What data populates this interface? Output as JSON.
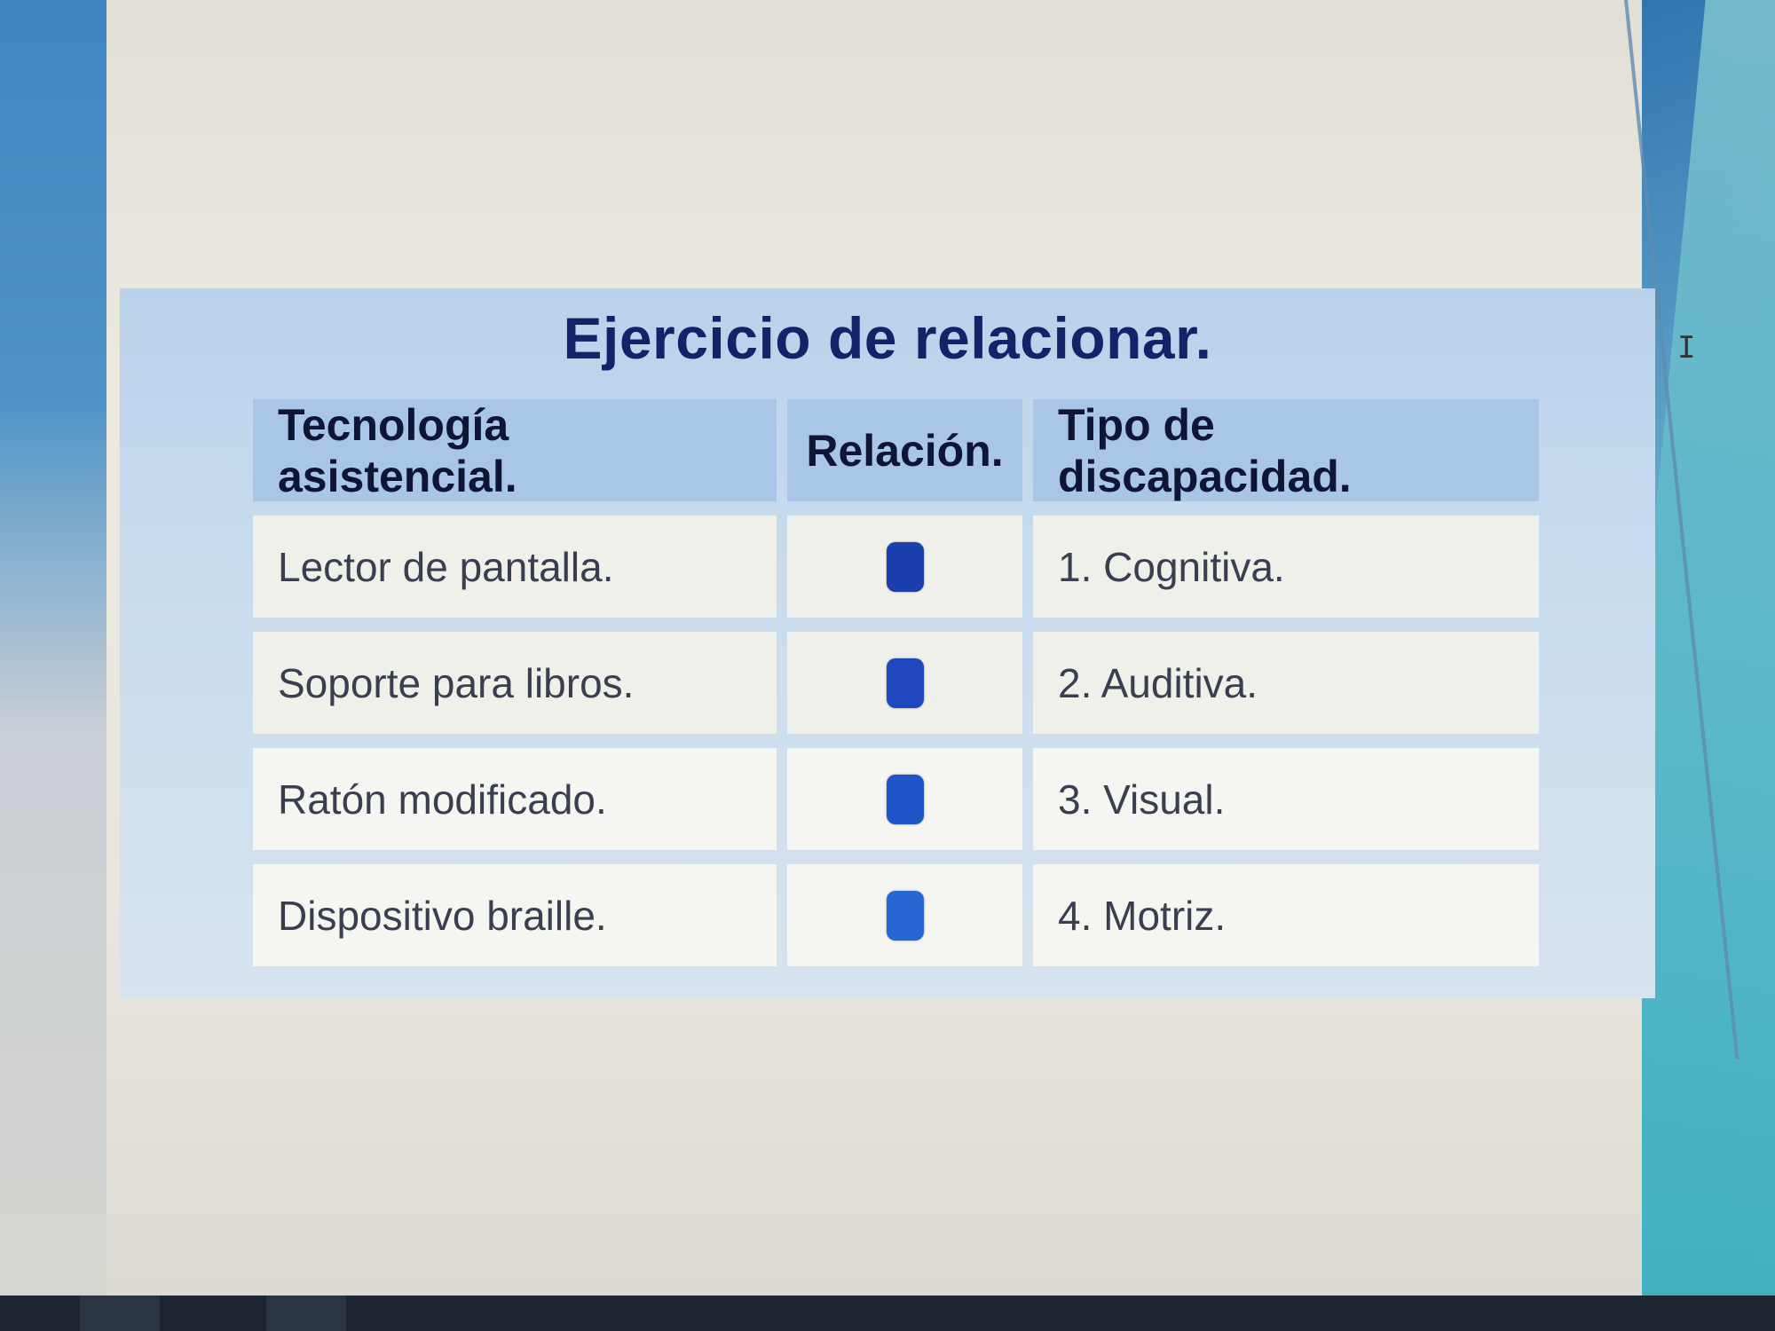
{
  "exercise": {
    "title": "Ejercicio de relacionar.",
    "headers": {
      "technology": "Tecnología asistencial.",
      "relation": "Relación.",
      "disability": "Tipo de discapacidad."
    },
    "rows": [
      {
        "technology": "Lector de pantalla.",
        "relation_marker": "drop-target",
        "disability": "1. Cognitiva."
      },
      {
        "technology": "Soporte para libros.",
        "relation_marker": "drop-target",
        "disability": "2. Auditiva."
      },
      {
        "technology": "Ratón modificado.",
        "relation_marker": "drop-target",
        "disability": "3. Visual."
      },
      {
        "technology": "Dispositivo braille.",
        "relation_marker": "drop-target",
        "disability": "4. Motriz."
      }
    ]
  },
  "colors": {
    "title": "#15226a",
    "header_bg": "#a9c6e6",
    "marker": "#1c3fae"
  },
  "icons": {
    "cursor": "text-cursor-icon"
  }
}
